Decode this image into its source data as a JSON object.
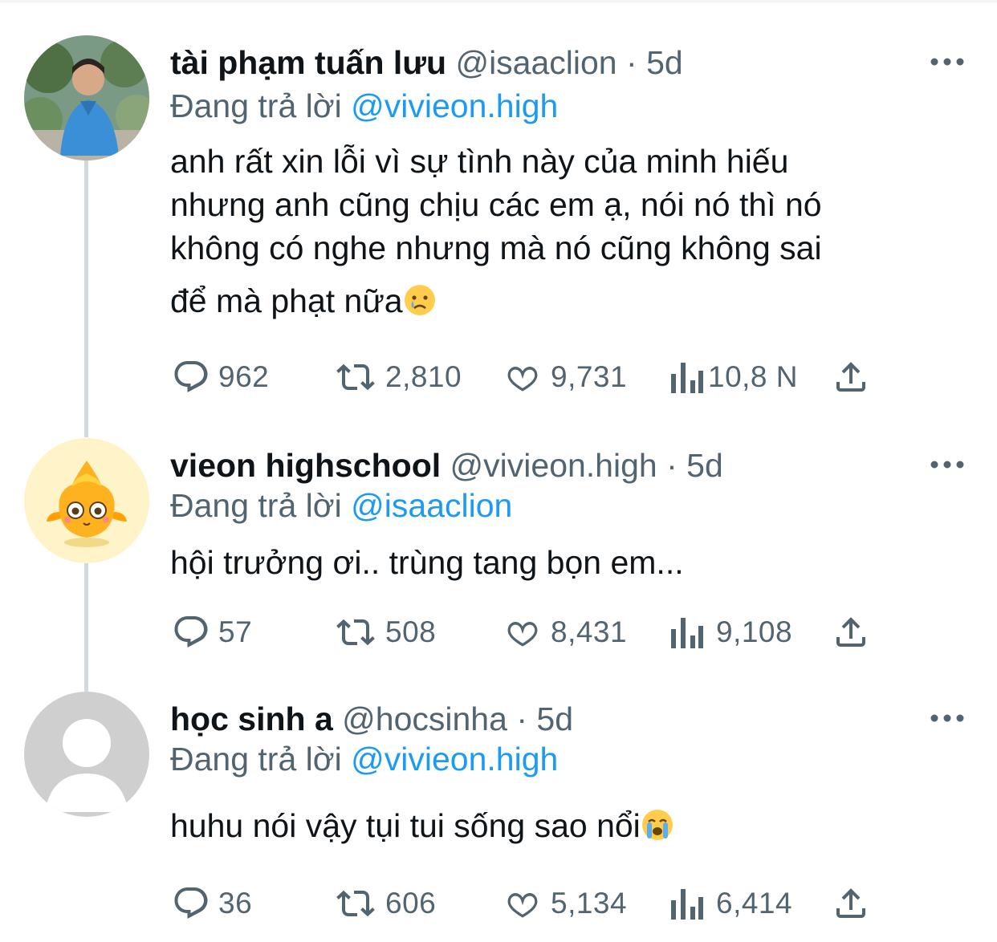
{
  "tweets": [
    {
      "name": "tài phạm tuấn lưu",
      "handle": "@isaaclion",
      "dot": "·",
      "time": "5d",
      "replying_prefix": "Đang trả lời",
      "replying_to": "@vivieon.high",
      "lines": [
        "anh rất xin lỗi vì sự tình này của minh hiếu",
        "nhưng anh cũng chịu các em ạ, nói nó thì nó",
        "không có nghe nhưng mà nó cũng không sai",
        "để mà phạt nữa"
      ],
      "emoji": "sad-tear-face-emoji",
      "replies": "962",
      "retweets": "2,810",
      "likes": "9,731",
      "views": "10,8 N",
      "avatar": "photo-avatar"
    },
    {
      "name": "vieon highschool",
      "handle": "@vivieon.high",
      "dot": "·",
      "time": "5d",
      "replying_prefix": "Đang trả lời",
      "replying_to": "@isaaclion",
      "lines": [
        "hội trưởng ơi.. trùng tang bọn em..."
      ],
      "replies": "57",
      "retweets": "508",
      "likes": "8,431",
      "views": "9,108",
      "avatar": "yellow-mascot-avatar"
    },
    {
      "name": "học sinh a",
      "handle": "@hocsinha",
      "dot": "·",
      "time": "5d",
      "replying_prefix": "Đang trả lời",
      "replying_to": "@vivieon.high",
      "lines": [
        "huhu nói vậy tụi tui sống sao nổi"
      ],
      "emoji": "loudly-crying-face-emoji",
      "replies": "36",
      "retweets": "606",
      "likes": "5,134",
      "views": "6,414",
      "avatar": "default-avatar"
    }
  ],
  "colors": {
    "text": "#0f1419",
    "secondary": "#536471",
    "link": "#1d9bf0",
    "thread_line": "#cfd9de"
  },
  "icons": [
    "reply-icon",
    "retweet-icon",
    "like-icon",
    "views-icon",
    "share-icon",
    "more-icon"
  ]
}
